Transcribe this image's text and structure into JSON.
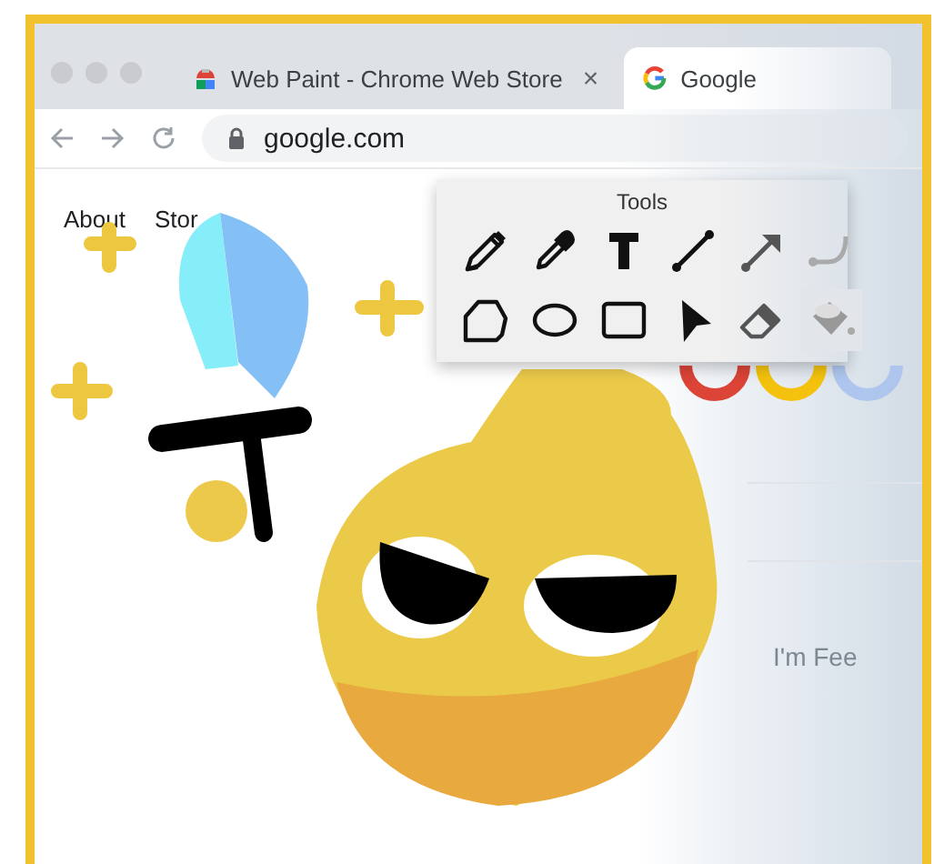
{
  "browser": {
    "tabs": [
      {
        "title": "Web Paint - Chrome Web Store",
        "selected": false,
        "close": "×"
      },
      {
        "title": "Google",
        "selected": true
      }
    ],
    "address": "google.com",
    "page": {
      "links": [
        "About",
        "Stor"
      ],
      "button": "I'm Fee"
    }
  },
  "tools_panel": {
    "title": "Tools",
    "tools": [
      {
        "kind": "pencil",
        "selected": false
      },
      {
        "kind": "eyedropper",
        "selected": false
      },
      {
        "kind": "text",
        "selected": false
      },
      {
        "kind": "line",
        "selected": false
      },
      {
        "kind": "arrow",
        "selected": false
      },
      {
        "kind": "curve",
        "selected": false
      },
      {
        "kind": "polygon",
        "selected": false
      },
      {
        "kind": "ellipse",
        "selected": false
      },
      {
        "kind": "rectangle",
        "selected": false
      },
      {
        "kind": "pointer",
        "selected": false
      },
      {
        "kind": "eraser",
        "selected": false
      },
      {
        "kind": "bucket",
        "selected": true
      }
    ]
  }
}
